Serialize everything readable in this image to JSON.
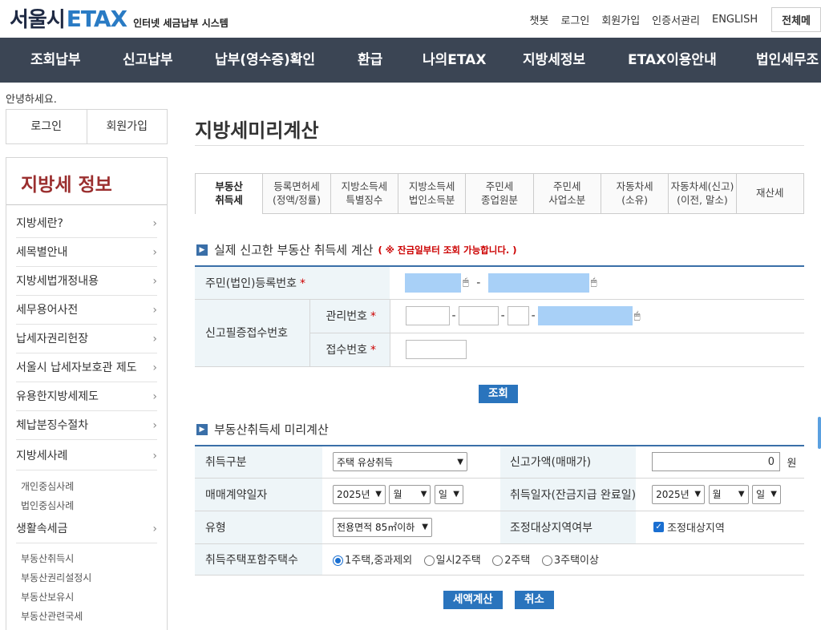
{
  "header": {
    "logo_main": "서울시",
    "logo_brand": "ETAX",
    "logo_sub": "인터넷 세금납부 시스템",
    "util_links": [
      "챗봇",
      "로그인",
      "회원가입",
      "인증서관리",
      "ENGLISH"
    ],
    "all_menu": "전체메"
  },
  "gnb": [
    "조회납부",
    "신고납부",
    "납부(영수증)확인",
    "환급",
    "나의ETAX",
    "지방세정보",
    "ETAX이용안내",
    "법인세무조"
  ],
  "greeting": "안녕하세요.",
  "login_box": {
    "login": "로그인",
    "join": "회원가입"
  },
  "sidebar": {
    "title": "지방세 정보",
    "items": [
      "지방세란?",
      "세목별안내",
      "지방세법개정내용",
      "세무용어사전",
      "납세자권리헌장",
      "서울시 납세자보호관 제도",
      "유용한지방세제도",
      "체납분징수절차",
      "지방세사례"
    ],
    "sub_items_1": [
      "개인중심사례",
      "법인중심사례"
    ],
    "item_living": "생활속세금",
    "sub_items_2": [
      "부동산취득시",
      "부동산권리설정시",
      "부동산보유시",
      "부동산관련국세"
    ],
    "chevron": "›"
  },
  "page_title": "지방세미리계산",
  "tabs": [
    "부동산\n취득세",
    "등록면허세\n(정액/정률)",
    "지방소득세\n특별징수",
    "지방소득세\n법인소득분",
    "주민세\n종업원분",
    "주민세\n사업소분",
    "자동차세\n(소유)",
    "자동차세(신고)\n(이전, 말소)",
    "재산세"
  ],
  "section1": {
    "title": "실제 신고한 부동산 취득세 계산",
    "note": "( ※ 잔금일부터 조회 가능합니다. )",
    "rows": {
      "rrn_label": "주민(법인)등록번호",
      "receipt_label": "신고필증접수번호",
      "mgmt_label": "관리번호",
      "accept_label": "접수번호"
    },
    "required_mark": "*",
    "dash": "-",
    "lookup_button": "조회"
  },
  "section2": {
    "title": "부동산취득세 미리계산",
    "acq_type_label": "취득구분",
    "acq_type_value": "주택 유상취득",
    "price_label": "신고가액(매매가)",
    "price_value": "0",
    "price_unit": "원",
    "contract_date_label": "매매계약일자",
    "acq_date_label": "취득일자(잔금지급 완료일)",
    "year_value": "2025년",
    "month_value": "월",
    "day_value": "일",
    "type_label": "유형",
    "type_value": "전용면적 85㎡이하",
    "adjust_label": "조정대상지역여부",
    "adjust_check_label": "조정대상지역",
    "adjust_checked": true,
    "house_count_label": "취득주택포함주택수",
    "house_options": [
      "1주택,중과제외",
      "일시2주택",
      "2주택",
      "3주택이상"
    ],
    "house_selected": 0,
    "calc_button": "세액계산",
    "cancel_button": "취소"
  },
  "colors": {
    "gnb_bg": "#3b4554",
    "brand_blue": "#2a7bc4",
    "button_blue": "#2a74bd",
    "sidebar_title": "#9b2f2f",
    "label_bg": "#eef5f8"
  }
}
